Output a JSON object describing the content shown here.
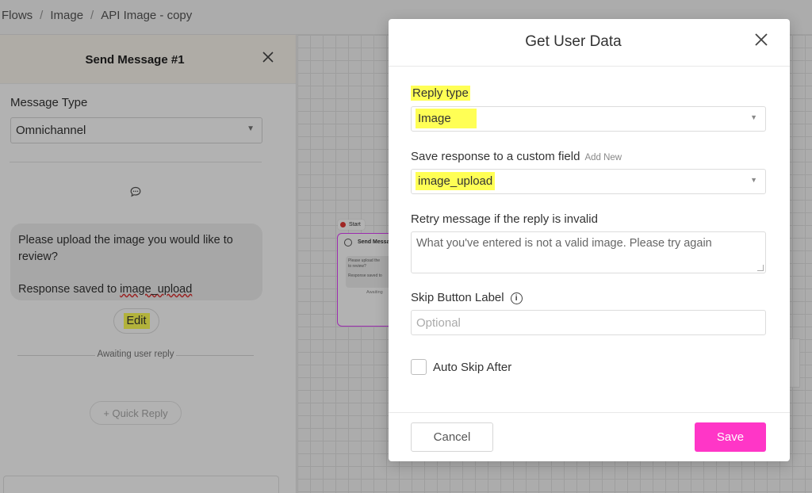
{
  "breadcrumb": {
    "items": [
      "Flows",
      "Image",
      "API Image - copy"
    ],
    "separator": "/"
  },
  "left_panel": {
    "title": "Send Message #1",
    "close_icon": "close-icon",
    "message_type_label": "Message Type",
    "message_type_value": "Omnichannel",
    "message": {
      "line1": "Please upload the image you would like to review?",
      "line2_prefix": "Response saved to ",
      "line2_variable": "image_upload"
    },
    "edit_label": "Edit",
    "awaiting_label": "Awaiting user reply",
    "quick_reply_label": "+ Quick Reply"
  },
  "canvas": {
    "start_label": "Start",
    "node_title": "Send Message",
    "node_text_line1": "Please upload the",
    "node_text_line2": "to review?",
    "node_text_line3": "Response saved to",
    "node_awaiting": "Awaiting"
  },
  "modal": {
    "title": "Get User Data",
    "reply_type_label": "Reply type",
    "reply_type_value": "Image",
    "save_response_label": "Save response to a custom field",
    "add_new_label": "Add New",
    "custom_field_value": "image_upload",
    "retry_label": "Retry message if the reply is invalid",
    "retry_message": "What you've entered is not a valid image. Please try again",
    "skip_label": "Skip Button Label",
    "skip_placeholder": "Optional",
    "auto_skip_label": "Auto Skip After",
    "auto_skip_checked": false,
    "cancel_label": "Cancel",
    "save_label": "Save"
  },
  "colors": {
    "accent": "#ff36c7",
    "highlight": "#ffff55",
    "node_border": "#e040fb"
  }
}
